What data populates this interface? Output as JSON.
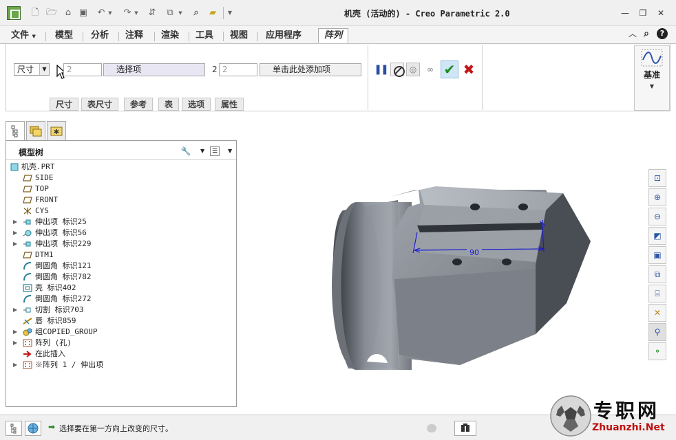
{
  "titlebar": {
    "title": "机壳 (活动的) - Creo Parametric 2.0",
    "controls": [
      "minimize",
      "maximize",
      "close"
    ]
  },
  "ribbon_tabs": [
    "文件",
    "模型",
    "分析",
    "注释",
    "渲染",
    "工具",
    "视图",
    "应用程序",
    "阵列"
  ],
  "ribbon_tab_active": "阵列",
  "pattern": {
    "type_select": "尺寸",
    "dir1_count": "2",
    "dir1_collector": "选择项",
    "dir2_label": "2",
    "dir2_count": "2",
    "dir2_collector": "单击此处添加项",
    "datum_label": "基准"
  },
  "subtabs": [
    "尺寸",
    "表尺寸",
    "参考",
    "表",
    "选项",
    "属性"
  ],
  "model_tree": {
    "title": "模型树",
    "root": "机壳.PRT",
    "items": [
      {
        "label": "SIDE",
        "icon": "datum-plane-icon",
        "expandable": false
      },
      {
        "label": "TOP",
        "icon": "datum-plane-icon",
        "expandable": false
      },
      {
        "label": "FRONT",
        "icon": "datum-plane-icon",
        "expandable": false
      },
      {
        "label": "CYS",
        "icon": "coordinate-system-icon",
        "expandable": false
      },
      {
        "label": "伸出项 标识25",
        "icon": "extrude-icon",
        "expandable": true
      },
      {
        "label": "伸出项 标识56",
        "icon": "revolve-icon",
        "expandable": true
      },
      {
        "label": "伸出项 标识229",
        "icon": "extrude-icon",
        "expandable": true
      },
      {
        "label": "DTM1",
        "icon": "datum-plane-icon",
        "expandable": false
      },
      {
        "label": "倒圆角 标识121",
        "icon": "round-icon",
        "expandable": false
      },
      {
        "label": "倒圆角 标识782",
        "icon": "round-icon",
        "expandable": false
      },
      {
        "label": "壳 标识402",
        "icon": "shell-icon",
        "expandable": false
      },
      {
        "label": "倒圆角 标识272",
        "icon": "round-icon",
        "expandable": false
      },
      {
        "label": "切割 标识703",
        "icon": "cut-icon",
        "expandable": true
      },
      {
        "label": "唇 标识859",
        "icon": "lip-icon",
        "expandable": false
      },
      {
        "label": "组COPIED_GROUP",
        "icon": "group-icon",
        "expandable": true
      },
      {
        "label": "阵列 (孔)",
        "icon": "pattern-icon",
        "expandable": true
      },
      {
        "label": "在此插入",
        "icon": "insert-here-icon",
        "expandable": false
      },
      {
        "label": "※阵列 1 / 伸出项",
        "icon": "pattern-icon",
        "expandable": true
      }
    ]
  },
  "model": {
    "dimension_value": "90"
  },
  "statusbar": {
    "message": "选择要在第一方向上改变的尺寸。"
  },
  "watermark": {
    "text": "专职网",
    "url": "Zhuanzhi.Net"
  },
  "colors": {
    "accent_blue": "#2a55a8",
    "ok_green": "#1f8a1f",
    "cancel_red": "#c21717",
    "model_gray": "#8c9098",
    "dimension_blue": "#1a1ad0"
  }
}
